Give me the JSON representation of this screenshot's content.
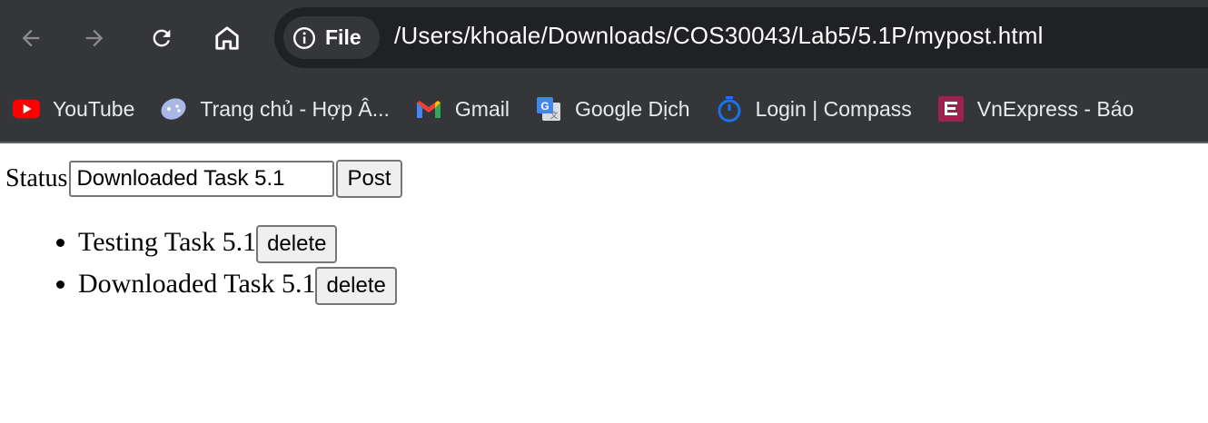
{
  "toolbar": {
    "back_icon": "arrow-left-icon",
    "forward_icon": "arrow-right-icon",
    "reload_icon": "reload-icon",
    "home_icon": "home-icon",
    "site_chip_label": "File",
    "site_chip_icon": "info-icon",
    "url": "/Users/khoale/Downloads/COS30043/Lab5/5.1P/mypost.html"
  },
  "bookmarks": [
    {
      "label": "YouTube",
      "icon": "youtube-icon"
    },
    {
      "label": "Trang chủ - Hợp Â...",
      "icon": "game-controller-icon"
    },
    {
      "label": "Gmail",
      "icon": "gmail-icon"
    },
    {
      "label": "Google Dịch",
      "icon": "google-translate-icon"
    },
    {
      "label": "Login | Compass",
      "icon": "compass-icon"
    },
    {
      "label": "VnExpress - Báo",
      "icon": "vnexpress-icon"
    }
  ],
  "form": {
    "label": "Status",
    "input_value": "Downloaded Task 5.1",
    "post_button": "Post"
  },
  "posts": [
    {
      "text": "Testing Task 5.1",
      "delete_label": "delete"
    },
    {
      "text": "Downloaded Task 5.1",
      "delete_label": "delete"
    }
  ],
  "colors": {
    "chrome_bg": "#35363a",
    "omnibox_bg": "#202124",
    "youtube_red": "#ff0000",
    "vnexpress_red": "#9f224e",
    "compass_blue": "#1a73e8"
  }
}
